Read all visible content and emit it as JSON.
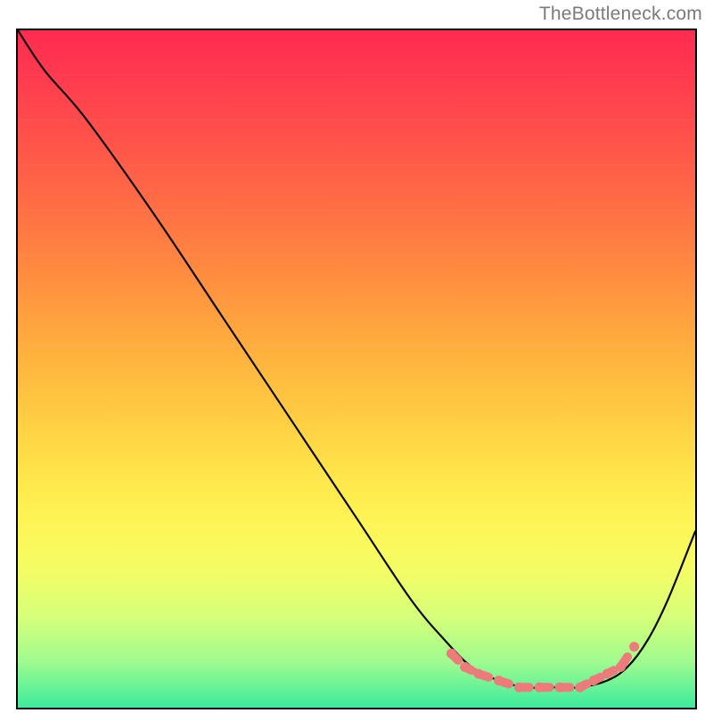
{
  "watermark": {
    "text": "TheBottleneck.com"
  },
  "frame": {
    "border_color": "#000000"
  },
  "gradient": {
    "top_color": "#ff2b50",
    "mid_color_a": "#ff993f",
    "mid_color_b": "#ffe84c",
    "bottom_color": "#3ceb9d"
  },
  "chart_data": {
    "type": "line",
    "title": "",
    "xlabel": "",
    "ylabel": "",
    "xlim": [
      0,
      100
    ],
    "ylim": [
      0,
      100
    ],
    "grid": false,
    "description": "Bottleneck curve inside a red→green gradient box. Percentages are relative to the inner frame (0 = left/bottom, 100 = right/top). Salmon markers along the trough.",
    "series": [
      {
        "name": "bottleneck-curve",
        "x": [
          0,
          4,
          10,
          20,
          30,
          40,
          50,
          58,
          63,
          67,
          71,
          75,
          79,
          83,
          87,
          90,
          93,
          96,
          100
        ],
        "y": [
          100,
          94,
          87,
          73,
          58,
          43,
          28,
          16,
          10,
          6,
          4,
          3,
          3,
          3,
          4,
          6,
          10,
          16,
          26
        ],
        "stroke": "#0a0a0a"
      }
    ],
    "markers": {
      "name": "trough-markers",
      "color": "#ee7b7b",
      "x": [
        64,
        66,
        68,
        71,
        74,
        77,
        80,
        83,
        85,
        87,
        89,
        91
      ],
      "y": [
        8,
        6,
        5,
        4,
        3,
        3,
        3,
        3,
        4,
        5,
        6,
        9
      ]
    }
  }
}
